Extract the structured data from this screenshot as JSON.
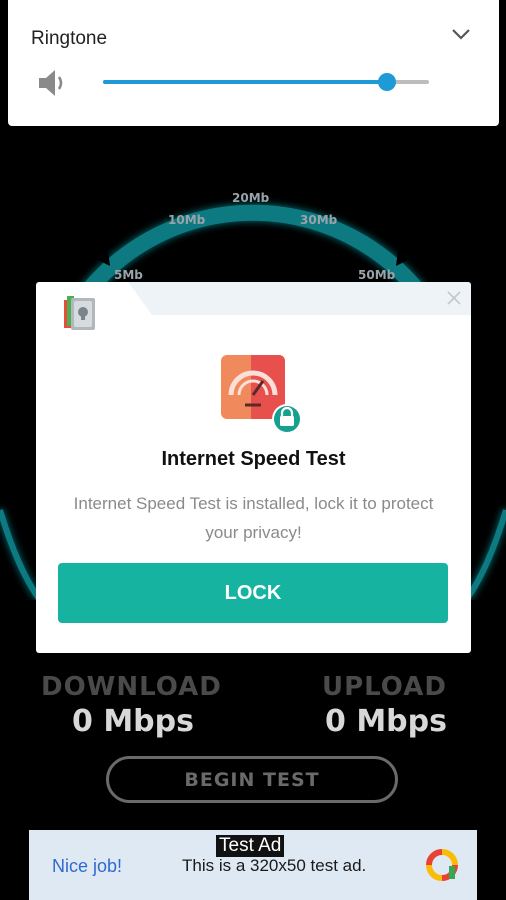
{
  "volume_panel": {
    "title": "Ringtone",
    "level_percent": 87
  },
  "gauge": {
    "tick_labels": [
      "5Mb",
      "10Mb",
      "20Mb",
      "30Mb",
      "50Mb"
    ]
  },
  "stats": {
    "download_label": "DOWNLOAD",
    "download_value": "0 Mbps",
    "upload_label": "UPLOAD",
    "upload_value": "0 Mbps"
  },
  "begin_label": "BEGIN TEST",
  "dialog": {
    "title": "Internet Speed Test",
    "message": "Internet Speed Test is installed, lock it to protect your privacy!",
    "lock_label": "LOCK"
  },
  "ad": {
    "badge": "Test Ad",
    "nice_job": "Nice job!",
    "text": "This is a 320x50 test ad."
  },
  "colors": {
    "accent": "#16b3a0",
    "slider": "#1e9ad6",
    "gauge": "#0e7a82"
  }
}
